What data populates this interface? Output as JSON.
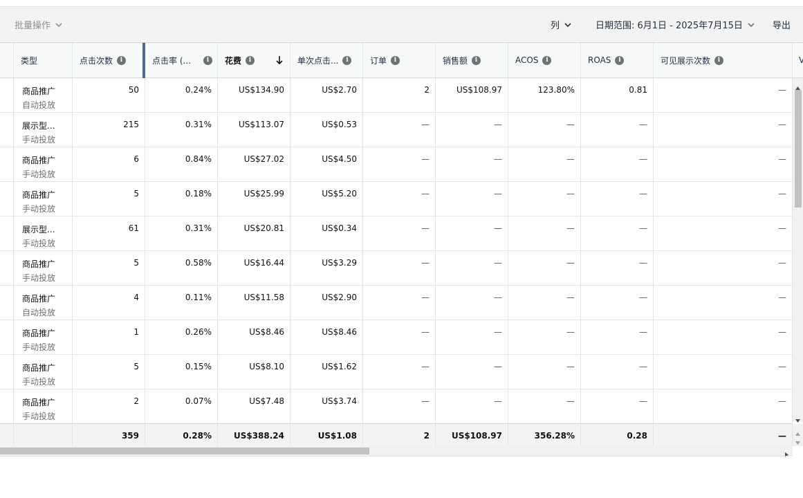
{
  "toolbar": {
    "bulk_actions": "批量操作",
    "columns": "列",
    "date_range": "日期范围: 6月1日 - 2025年7月15日",
    "export": "导出"
  },
  "header": {
    "cols": [
      {
        "label": "类型"
      },
      {
        "label": "点击次数"
      },
      {
        "label": "点击率 (..."
      },
      {
        "label": "花费",
        "sorted": "descending"
      },
      {
        "label": "单次点击..."
      },
      {
        "label": "订单"
      },
      {
        "label": "销售额"
      },
      {
        "label": "ACOS"
      },
      {
        "label": "ROAS"
      },
      {
        "label": "可见展示次数"
      },
      {
        "label": "V"
      }
    ]
  },
  "rows": [
    {
      "type": "商品推广",
      "targeting": "自动投放",
      "clicks": "50",
      "ctr": "0.24%",
      "spend": "US$134.90",
      "cpc": "US$2.70",
      "orders": "2",
      "sales": "US$108.97",
      "acos": "123.80%",
      "roas": "0.81",
      "vimp": "—"
    },
    {
      "type": "展示型...",
      "targeting": "手动投放",
      "clicks": "215",
      "ctr": "0.31%",
      "spend": "US$113.07",
      "cpc": "US$0.53",
      "orders": "—",
      "sales": "—",
      "acos": "—",
      "roas": "—",
      "vimp": "—"
    },
    {
      "type": "商品推广",
      "targeting": "手动投放",
      "clicks": "6",
      "ctr": "0.84%",
      "spend": "US$27.02",
      "cpc": "US$4.50",
      "orders": "—",
      "sales": "—",
      "acos": "—",
      "roas": "—",
      "vimp": "—"
    },
    {
      "type": "商品推广",
      "targeting": "手动投放",
      "clicks": "5",
      "ctr": "0.18%",
      "spend": "US$25.99",
      "cpc": "US$5.20",
      "orders": "—",
      "sales": "—",
      "acos": "—",
      "roas": "—",
      "vimp": "—"
    },
    {
      "type": "展示型...",
      "targeting": "手动投放",
      "clicks": "61",
      "ctr": "0.31%",
      "spend": "US$20.81",
      "cpc": "US$0.34",
      "orders": "—",
      "sales": "—",
      "acos": "—",
      "roas": "—",
      "vimp": "—"
    },
    {
      "type": "商品推广",
      "targeting": "手动投放",
      "clicks": "5",
      "ctr": "0.58%",
      "spend": "US$16.44",
      "cpc": "US$3.29",
      "orders": "—",
      "sales": "—",
      "acos": "—",
      "roas": "—",
      "vimp": "—"
    },
    {
      "type": "商品推广",
      "targeting": "自动投放",
      "clicks": "4",
      "ctr": "0.11%",
      "spend": "US$11.58",
      "cpc": "US$2.90",
      "orders": "—",
      "sales": "—",
      "acos": "—",
      "roas": "—",
      "vimp": "—"
    },
    {
      "type": "商品推广",
      "targeting": "手动投放",
      "clicks": "1",
      "ctr": "0.26%",
      "spend": "US$8.46",
      "cpc": "US$8.46",
      "orders": "—",
      "sales": "—",
      "acos": "—",
      "roas": "—",
      "vimp": "—"
    },
    {
      "type": "商品推广",
      "targeting": "手动投放",
      "clicks": "5",
      "ctr": "0.15%",
      "spend": "US$8.10",
      "cpc": "US$1.62",
      "orders": "—",
      "sales": "—",
      "acos": "—",
      "roas": "—",
      "vimp": "—"
    },
    {
      "type": "商品推广",
      "targeting": "手动投放",
      "clicks": "2",
      "ctr": "0.07%",
      "spend": "US$7.48",
      "cpc": "US$3.74",
      "orders": "—",
      "sales": "—",
      "acos": "—",
      "roas": "—",
      "vimp": "—"
    }
  ],
  "totals": {
    "clicks": "359",
    "ctr": "0.28%",
    "spend": "US$388.24",
    "cpc": "US$1.08",
    "orders": "2",
    "sales": "US$108.97",
    "acos": "356.28%",
    "roas": "0.28",
    "vimp": "—"
  },
  "icons": {
    "info": "info-icon",
    "sort": "arrow-down-icon",
    "dropdown": "chevron-down-icon"
  },
  "colors": {
    "accent": "#4a6a96",
    "header_bg": "#f7f8f8",
    "toolbar_bg": "#f3f3f3"
  }
}
